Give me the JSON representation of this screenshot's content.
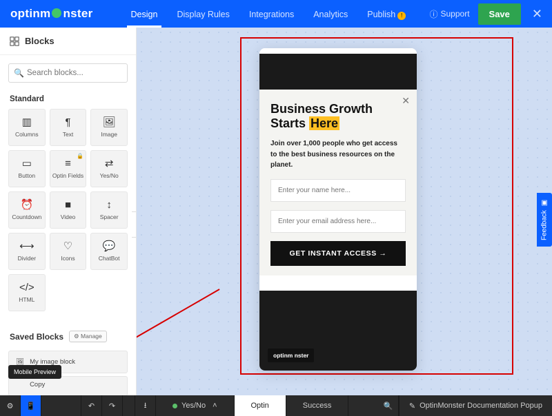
{
  "brand": "optinmonster",
  "nav": {
    "design": "Design",
    "display_rules": "Display Rules",
    "integrations": "Integrations",
    "analytics": "Analytics",
    "publish": "Publish"
  },
  "top": {
    "support": "Support",
    "save": "Save"
  },
  "sidebar": {
    "header": "Blocks",
    "search_placeholder": "Search blocks...",
    "section_standard": "Standard",
    "blocks": {
      "columns": "Columns",
      "text": "Text",
      "image": "Image",
      "button": "Button",
      "optin_fields": "Optin Fields",
      "yes_no": "Yes/No",
      "countdown": "Countdown",
      "video": "Video",
      "spacer": "Spacer",
      "divider": "Divider",
      "icons": "Icons",
      "chatbot": "ChatBot",
      "html": "HTML"
    },
    "saved_header": "Saved Blocks",
    "manage": "Manage",
    "saved_items": {
      "my_image_block": "My image block",
      "copy_suffix": "Copy"
    },
    "mobile_tip": "Mobile Preview"
  },
  "popup": {
    "headline_a": "Business Growth",
    "headline_b": "Starts ",
    "headline_hl": "Here",
    "sub": "Join over 1,000 people who get access to the best business resources on the planet.",
    "name_ph": "Enter your name here...",
    "email_ph": "Enter your email address here...",
    "cta": "GET INSTANT ACCESS →",
    "brand": "optinm  nster"
  },
  "feedback": "Feedback",
  "bottom": {
    "yes_no": "Yes/No",
    "optin": "Optin",
    "success": "Success",
    "campaign_name": "OptinMonster Documentation Popup"
  }
}
